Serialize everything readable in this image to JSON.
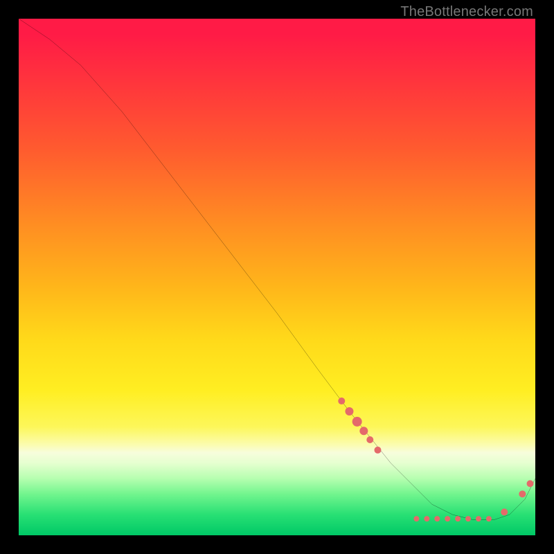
{
  "watermark": "TheBottlenecker.com",
  "chart_data": {
    "type": "line",
    "title": "",
    "xlabel": "",
    "ylabel": "",
    "xlim": [
      0,
      100
    ],
    "ylim": [
      0,
      100
    ],
    "series": [
      {
        "name": "bottleneck-curve",
        "x": [
          0,
          6,
          12,
          20,
          30,
          40,
          50,
          58,
          64,
          68,
          72,
          76,
          80,
          84,
          88,
          92,
          95,
          98,
          100
        ],
        "y": [
          100,
          96,
          91,
          82,
          69,
          56,
          43,
          32,
          24,
          19,
          14,
          10,
          6,
          4,
          3,
          3,
          4,
          7,
          11
        ]
      }
    ],
    "markers": [
      {
        "x": 62.5,
        "y": 26.0,
        "r": 5
      },
      {
        "x": 64.0,
        "y": 24.0,
        "r": 6
      },
      {
        "x": 65.5,
        "y": 22.0,
        "r": 7
      },
      {
        "x": 66.8,
        "y": 20.2,
        "r": 6
      },
      {
        "x": 68.0,
        "y": 18.5,
        "r": 5
      },
      {
        "x": 69.5,
        "y": 16.5,
        "r": 5
      },
      {
        "x": 77.0,
        "y": 3.2,
        "r": 4
      },
      {
        "x": 79.0,
        "y": 3.2,
        "r": 4
      },
      {
        "x": 81.0,
        "y": 3.2,
        "r": 4
      },
      {
        "x": 83.0,
        "y": 3.2,
        "r": 4
      },
      {
        "x": 85.0,
        "y": 3.2,
        "r": 4
      },
      {
        "x": 87.0,
        "y": 3.2,
        "r": 4
      },
      {
        "x": 89.0,
        "y": 3.2,
        "r": 4
      },
      {
        "x": 91.0,
        "y": 3.2,
        "r": 4
      },
      {
        "x": 94.0,
        "y": 4.5,
        "r": 5
      },
      {
        "x": 97.5,
        "y": 8.0,
        "r": 5
      },
      {
        "x": 99.0,
        "y": 10.0,
        "r": 5
      }
    ],
    "marker_color": "#e46a6a",
    "line_color": "#000000",
    "line_width": 2
  }
}
